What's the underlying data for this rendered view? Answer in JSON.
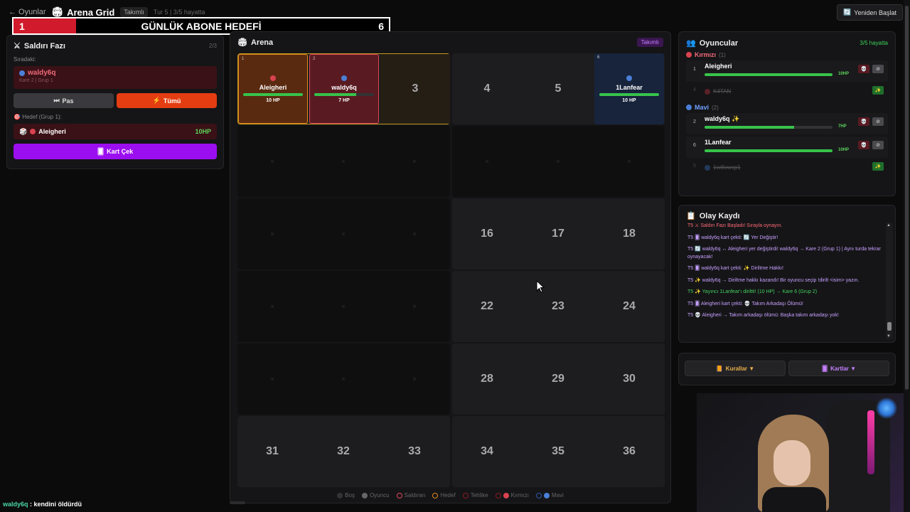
{
  "topbar": {
    "back": "← Oyunlar",
    "title": "Arena Grid",
    "mode": "Takımlı",
    "turn": "Tur 5 | 3/5 hayatta",
    "restart": "Yeniden Başlat"
  },
  "subgoal": {
    "current": "1",
    "label": "GÜNLÜK ABONE HEDEFİ",
    "target": "6",
    "progress_fraction": 0.167
  },
  "phase": {
    "title": "Saldırı Fazı",
    "count": "2/3",
    "next_label": "Sıradaki:",
    "current_name": "waldy6q",
    "current_sub": "Kare 2 | Grup 1",
    "pass": "Pas",
    "all": "Tümü",
    "target_label": "Hedef (Grup 1):",
    "target_name": "Aleigheri",
    "target_hp": "10HP",
    "draw": "Kart Çek"
  },
  "arena": {
    "title": "Arena",
    "tag": "Takımlı",
    "cells": {
      "c1": {
        "idx": "1",
        "name": "Aleigheri",
        "hp": "10 HP",
        "hp_fraction": 1.0
      },
      "c2": {
        "idx": "2",
        "name": "waldy6q",
        "hp": "7 HP",
        "hp_fraction": 0.7
      },
      "c3": "3",
      "c4": "4",
      "c5": "5",
      "c6": {
        "idx": "6",
        "name": "1Lanfear",
        "hp": "10 HP",
        "hp_fraction": 1.0
      },
      "c16": "16",
      "c17": "17",
      "c18": "18",
      "c22": "22",
      "c23": "23",
      "c24": "24",
      "c28": "28",
      "c29": "29",
      "c30": "30",
      "c31": "31",
      "c32": "32",
      "c33": "33",
      "c34": "34",
      "c35": "35",
      "c36": "36",
      "blocked": "×"
    },
    "legend": {
      "bos": "Boş",
      "oyuncu": "Oyuncu",
      "saldiran": "Saldıran",
      "hedef": "Hedef",
      "tehlike": "Tehlike",
      "kirmizi": "Kırmızı",
      "mavi": "Mavi"
    }
  },
  "players": {
    "title": "Oyuncular",
    "alive": "3/5 hayatta",
    "red_team": "Kırmızı",
    "red_count": "(1)",
    "blue_team": "Mavi",
    "blue_count": "(2)",
    "p1": {
      "no": "1",
      "name": "Aleigheri",
      "hp": "10HP",
      "hp_fraction": 1.0
    },
    "p_dead1": {
      "no": "4",
      "name": "K4TAN"
    },
    "p2": {
      "no": "2",
      "name": "waldy6q",
      "hp": "7HP",
      "hp_fraction": 0.7
    },
    "p6": {
      "no": "6",
      "name": "1Lanfear",
      "hp": "10HP",
      "hp_fraction": 1.0
    },
    "p_dead2": {
      "no": "5",
      "name": "1willowsp1"
    }
  },
  "log": {
    "title": "Olay Kaydı",
    "lines": [
      "T5 ⚔ Saldırı Fazı Başladı! Sırayla oynayın.",
      "T5 🂠 waldy6q kart çekti: 🔄 Yer Değiştir!",
      "T5 🔄 waldy6q ↔ Aleigheri yer değiştirdi! waldy6q → Kare 2 (Grup 1) | Aynı turda tekrar oynayacak!",
      "T5 🂠 waldy6q kart çekti: ✨ Diriltme Hakkı!",
      "T5 ✨ waldy6q → Diriltme hakkı kazandı! Bir oyuncu seçip !dirilt <isim> yazın.",
      "T5 ✨ Yayıncı 1Lanfear'ı diriltti! (10 HP) → Kare 6 (Grup 2)",
      "T5 🂠 Aleigheri kart çekti: 💀 Takım Arkadaşı Ölümü!",
      "T5 💀 Aleigheri → Takım arkadaşı ölümü: Başka takım arkadaşı yok!"
    ]
  },
  "buttons": {
    "rules": "Kurallar ▼",
    "cards": "Kartlar ▼"
  },
  "killfeed": {
    "who": "waldy6q",
    "text": " : kendini öldürdü"
  },
  "colors": {
    "red": "#d9434f",
    "blue": "#4a7fd6",
    "accent_purple": "#9b0ef0",
    "gold": "#c59a22"
  }
}
